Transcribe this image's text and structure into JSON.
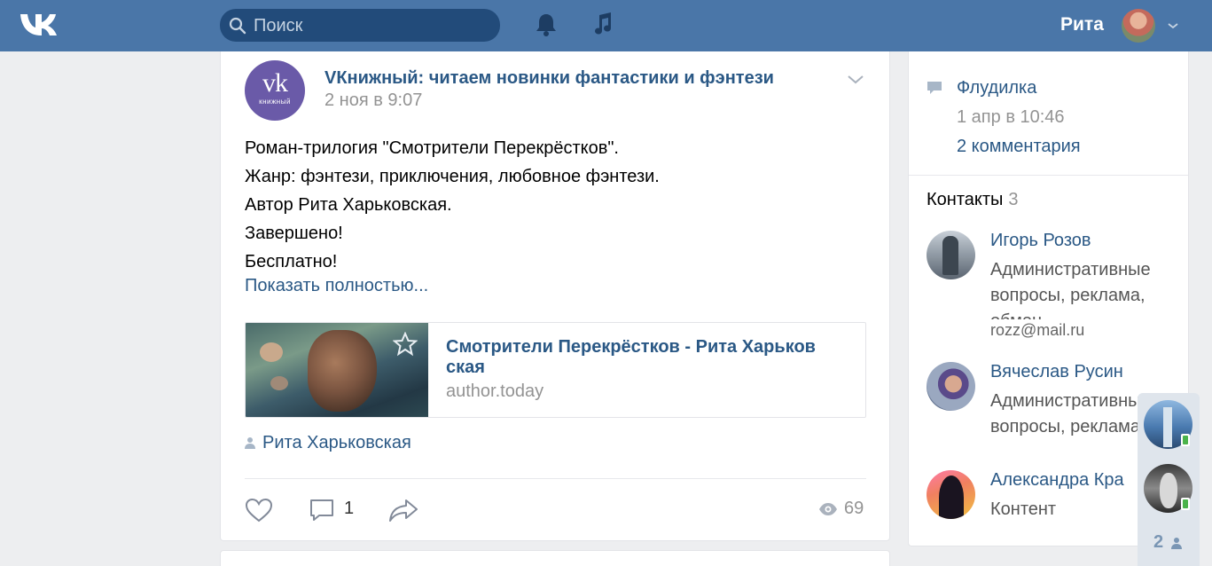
{
  "header": {
    "search_placeholder": "Поиск",
    "username": "Рита"
  },
  "post": {
    "avatar_text": "vk",
    "avatar_subtext": "книжный",
    "author": "VКнижный: читаем новинки фантастики и фэнтези",
    "date": "2 ноя в 9:07",
    "lines": [
      "Роман-трилогия \"Смотрители Перекрёстков\".",
      "Жанр: фэнтези, приключения, любовное фэнтези.",
      "Автор Рита Харьковская.",
      "Завершено!",
      "Бесплатно!"
    ],
    "show_more": "Показать полностью...",
    "link": {
      "title": "Смотрители Перекрёстков - Рита Харьков ская",
      "domain": "author.today"
    },
    "signer": "Рита Харьковская",
    "comments": "1",
    "views": "69"
  },
  "sidebar": {
    "topic": {
      "title": "Флудилка",
      "date": "1 апр в 10:46",
      "comments": "2 комментария"
    },
    "contacts_title": "Контакты",
    "contacts_count": "3",
    "contacts": [
      {
        "name": "Игорь Розов",
        "role": "Административные вопросы, реклама, обмен",
        "email": "rozz@mail.ru"
      },
      {
        "name": "Вячеслав Русин",
        "role": "Административные вопросы, реклама"
      },
      {
        "name": "Александра Кра",
        "role": "Контент"
      }
    ]
  },
  "chat": {
    "count": "2"
  },
  "colors": {
    "header_bg": "#4a76a8",
    "link": "#2a5885",
    "muted": "#939393",
    "page_bg": "#edeef0"
  }
}
